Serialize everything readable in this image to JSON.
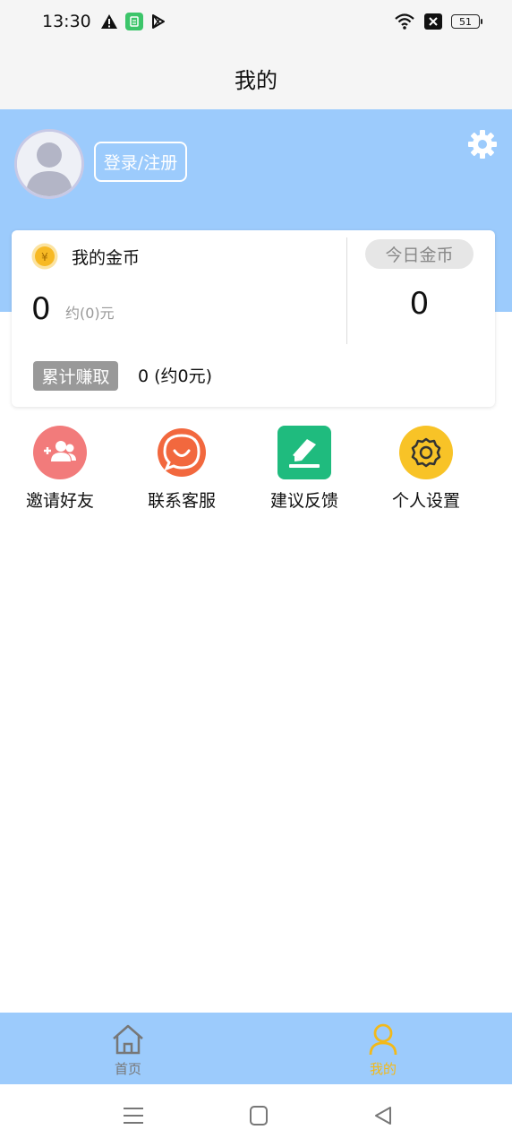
{
  "status_bar": {
    "time": "13:30",
    "battery": "51",
    "left_icons": [
      "warning-icon",
      "app-notification-icon",
      "play-store-icon"
    ],
    "right_icons": [
      "wifi-icon",
      "close-box-icon",
      "battery-icon"
    ]
  },
  "header": {
    "title": "我的"
  },
  "profile": {
    "login_label": "登录/注册",
    "band_color": "#9ccbfc"
  },
  "coins": {
    "title": "我的金币",
    "value": "0",
    "approx": "约(0)元",
    "today_label": "今日金币",
    "today_value": "0",
    "total_label": "累计赚取",
    "total_value": "0 (约0元)"
  },
  "actions": [
    {
      "label": "邀请好友",
      "icon": "invite-friends-icon",
      "color": "#f27b7b"
    },
    {
      "label": "联系客服",
      "icon": "customer-service-icon",
      "color": "#f2683e"
    },
    {
      "label": "建议反馈",
      "icon": "feedback-icon",
      "color": "#1fbb7e"
    },
    {
      "label": "个人设置",
      "icon": "personal-settings-icon",
      "color": "#f8c327"
    }
  ],
  "tabs": [
    {
      "label": "首页",
      "icon": "home-icon",
      "active": false,
      "color": "#777777"
    },
    {
      "label": "我的",
      "icon": "profile-icon",
      "active": true,
      "color": "#f2b91a"
    }
  ],
  "nav": [
    "menu-icon",
    "home-square-icon",
    "back-triangle-icon"
  ]
}
